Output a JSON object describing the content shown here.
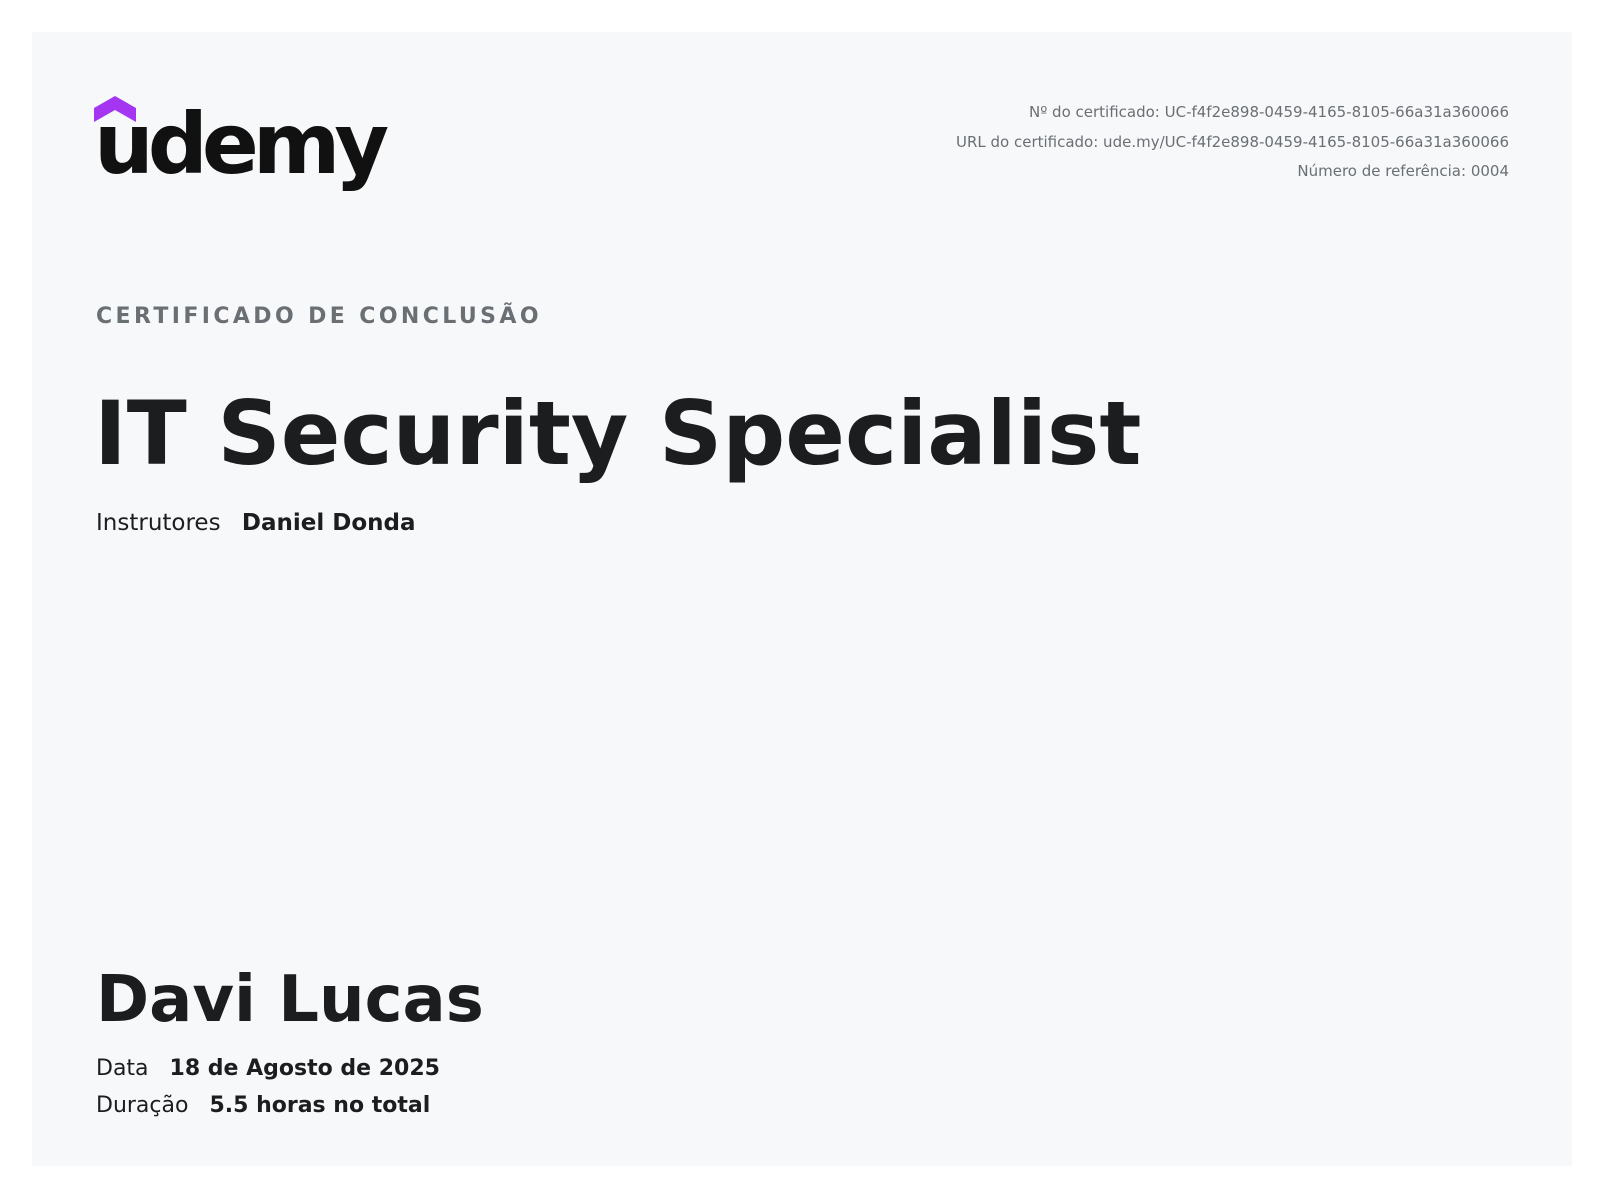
{
  "brand": {
    "logo_text": "udemy",
    "accent_color": "#a435f0"
  },
  "meta": {
    "certificate_number": "Nº do certificado: UC-f4f2e898-0459-4165-8105-66a31a360066",
    "certificate_url": "URL do certificado: ude.my/UC-f4f2e898-0459-4165-8105-66a31a360066",
    "reference_number": "Número de referência: 0004"
  },
  "certificate": {
    "overline": "CERTIFICADO DE CONCLUSÃO",
    "course_title": "IT Security Specialist",
    "instructors_label": "Instrutores",
    "instructors_value": "Daniel Donda",
    "student_name": "Davi Lucas",
    "date_label": "Data",
    "date_value": "18 de Agosto de 2025",
    "duration_label": "Duração",
    "duration_value": "5.5 horas no total"
  }
}
